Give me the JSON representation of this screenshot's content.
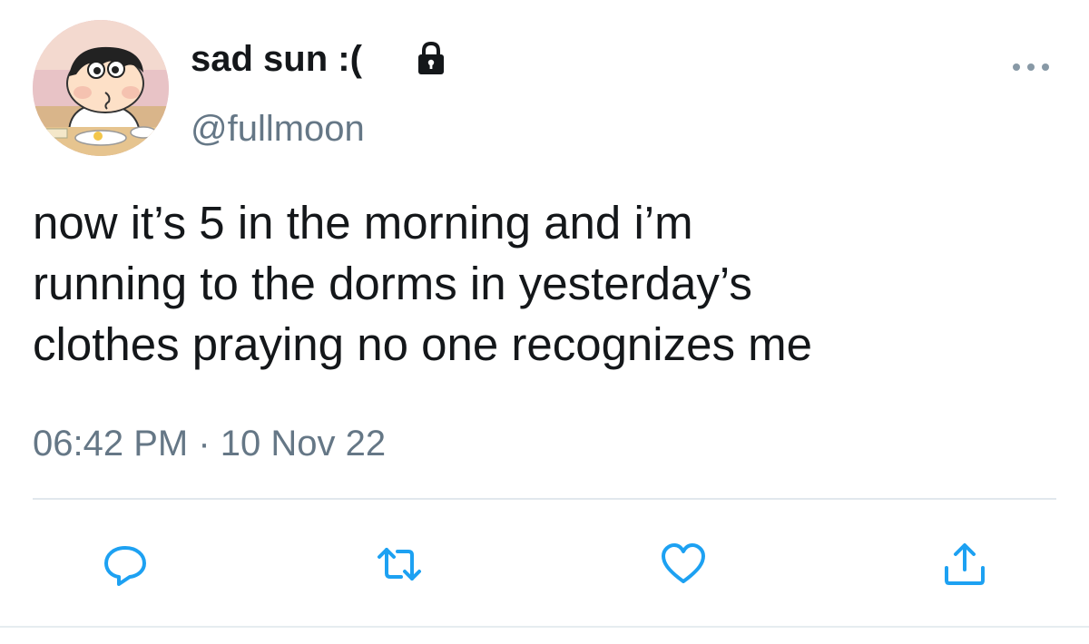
{
  "user": {
    "display_name": "sad sun :(",
    "handle": "@fullmoon",
    "avatar_icon": "cartoon-avatar",
    "protected_icon": "lock-icon"
  },
  "tweet": {
    "text": "now it’s 5 in the morning and i’m\nrunning to the dorms in yesterday’s\nclothes praying no one recognizes me",
    "timestamp": "06:42 PM · 10 Nov 22"
  },
  "actions": [
    {
      "name": "reply",
      "icon": "reply-icon"
    },
    {
      "name": "retweet",
      "icon": "retweet-icon"
    },
    {
      "name": "like",
      "icon": "heart-icon"
    },
    {
      "name": "share",
      "icon": "share-icon"
    }
  ],
  "colors": {
    "text": "#14171a",
    "secondary": "#657786",
    "icon": "#1da1f2",
    "divider": "#e1e8ed"
  }
}
